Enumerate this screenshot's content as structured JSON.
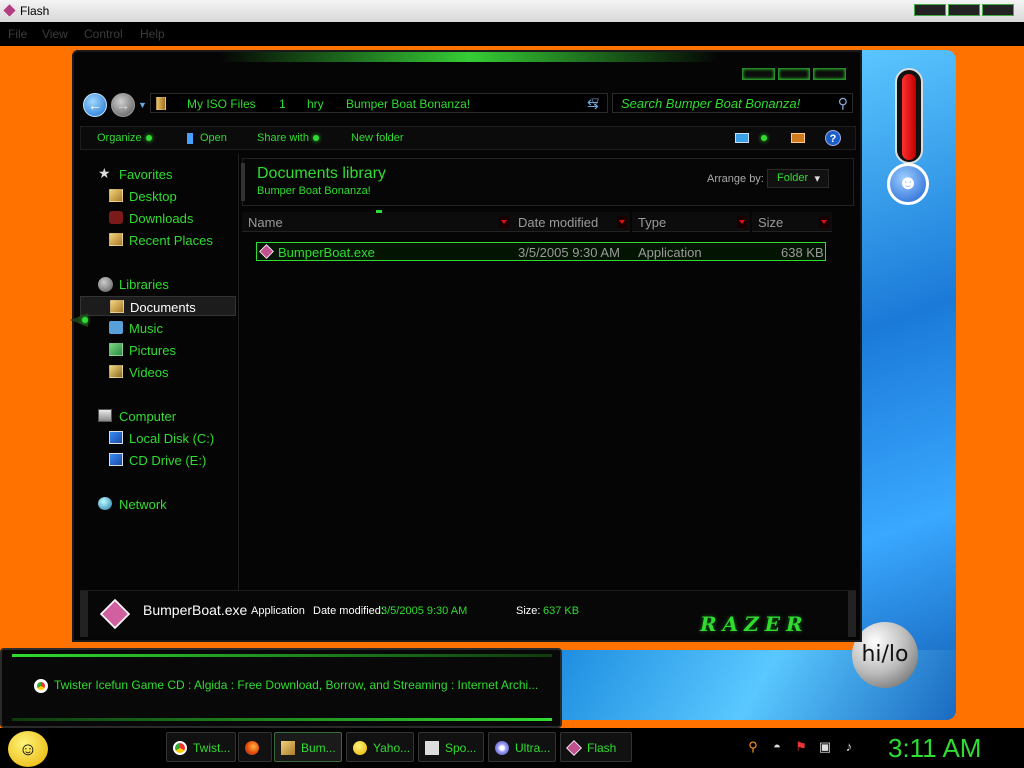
{
  "flash": {
    "title": "Flash",
    "menu": [
      "File",
      "View",
      "Control",
      "Help"
    ]
  },
  "explorer": {
    "address": {
      "segments": [
        "My ISO Files",
        "1",
        "hry",
        "Bumper Boat Bonanza!"
      ]
    },
    "search": {
      "placeholder": "Search Bumper Boat Bonanza!"
    },
    "toolbar": {
      "organize": "Organize",
      "open": "Open",
      "share_with": "Share with",
      "new_folder": "New folder",
      "help": "?"
    },
    "nav": {
      "favorites": "Favorites",
      "desktop": "Desktop",
      "downloads": "Downloads",
      "recent_places": "Recent Places",
      "libraries": "Libraries",
      "documents": "Documents",
      "music": "Music",
      "pictures": "Pictures",
      "videos": "Videos",
      "computer": "Computer",
      "local_disk": "Local Disk (C:)",
      "cd_drive": "CD Drive (E:)",
      "network": "Network"
    },
    "library": {
      "title": "Documents library",
      "subtitle": "Bumper Boat Bonanza!",
      "arrange_label": "Arrange by:",
      "arrange_value": "Folder"
    },
    "columns": {
      "name": "Name",
      "date_modified": "Date modified",
      "type": "Type",
      "size": "Size"
    },
    "files": [
      {
        "name": "BumperBoat.exe",
        "date_modified": "3/5/2005 9:30 AM",
        "type": "Application",
        "size": "638 KB"
      }
    ],
    "details": {
      "name": "BumperBoat.exe",
      "type": "Application",
      "date_label": "Date modified:",
      "date_value": "3/5/2005 9:30 AM",
      "size_label": "Size:",
      "size_value": "637 KB",
      "brand": "RAZER"
    }
  },
  "gadget": {
    "text": "Twister Icefun Game CD : Algida : Free Download, Borrow, and Streaming : Internet Archi..."
  },
  "decor": {
    "hilo": "hi/lo"
  },
  "taskbar": {
    "items": [
      {
        "label": "Twist...",
        "icon": "chrome-icon"
      },
      {
        "label": "",
        "icon": "firefox-icon"
      },
      {
        "label": "Bum...",
        "icon": "folder-icon"
      },
      {
        "label": "Yaho...",
        "icon": "yahoo-icon"
      },
      {
        "label": "Spo...",
        "icon": "spotify-icon"
      },
      {
        "label": "Ultra...",
        "icon": "ultraiso-icon"
      },
      {
        "label": "Flash",
        "icon": "flash-icon"
      }
    ],
    "clock": "3:11 AM"
  },
  "colors": {
    "accent": "#2fdc2f",
    "desktop": "#ff7200",
    "window_bg": "#050505"
  }
}
